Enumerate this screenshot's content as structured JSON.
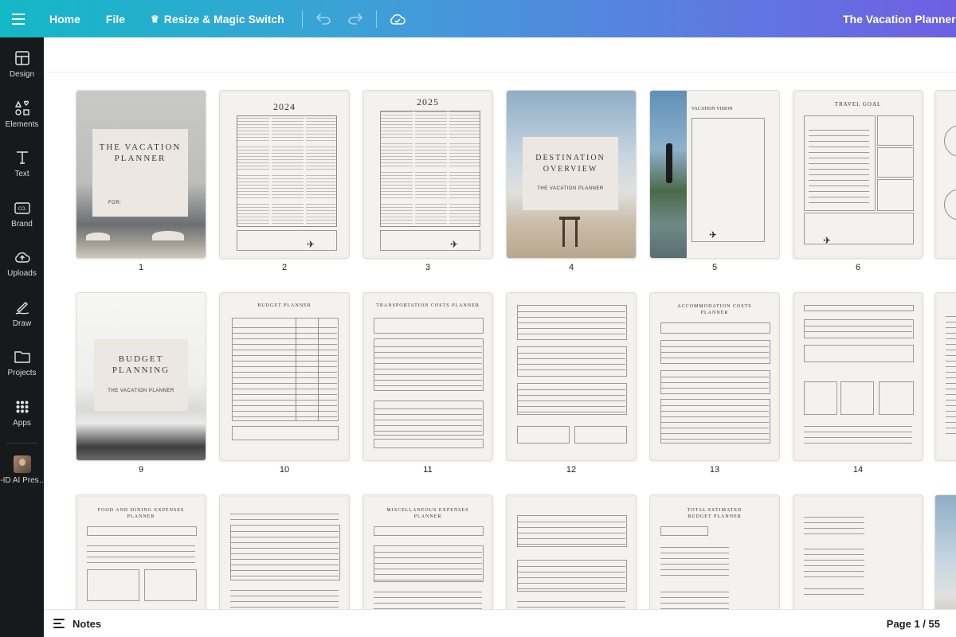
{
  "topbar": {
    "home": "Home",
    "file": "File",
    "resize": "Resize & Magic Switch",
    "title": "The Vacation Planner by"
  },
  "sidebar": {
    "items": [
      {
        "label": "Design",
        "icon": "layout-icon"
      },
      {
        "label": "Elements",
        "icon": "shapes-icon"
      },
      {
        "label": "Text",
        "icon": "text-icon"
      },
      {
        "label": "Brand",
        "icon": "brand-icon"
      },
      {
        "label": "Uploads",
        "icon": "upload-cloud-icon"
      },
      {
        "label": "Draw",
        "icon": "pen-icon"
      },
      {
        "label": "Projects",
        "icon": "folder-icon"
      },
      {
        "label": "Apps",
        "icon": "apps-grid-icon"
      }
    ],
    "profile_label": "-ID AI Pres…"
  },
  "pages": [
    {
      "num": "1",
      "title": "THE VACATION PLANNER",
      "sub": "FOR:"
    },
    {
      "num": "2",
      "title": "2024"
    },
    {
      "num": "3",
      "title": "2025"
    },
    {
      "num": "4",
      "title": "DESTINATION OVERVIEW",
      "sub": "THE VACATION PLANNER"
    },
    {
      "num": "5",
      "title": "VACATION VISION"
    },
    {
      "num": "6",
      "title": "TRAVEL GOAL"
    },
    {
      "num": "9",
      "title": "BUDGET PLANNING",
      "sub": "THE VACATION PLANNER"
    },
    {
      "num": "10",
      "title": "BUDGET PLANNER"
    },
    {
      "num": "11",
      "title": "TRANSPORTATION COSTS PLANNER"
    },
    {
      "num": "12",
      "title": ""
    },
    {
      "num": "13",
      "title": "ACCOMMODATION COSTS PLANNER"
    },
    {
      "num": "14",
      "title": ""
    },
    {
      "num": "",
      "title": "FOOD AND DINING EXPENSES PLANNER"
    },
    {
      "num": "",
      "title": ""
    },
    {
      "num": "",
      "title": "MISCELLANEOUS EXPENSES PLANNER"
    },
    {
      "num": "",
      "title": ""
    },
    {
      "num": "",
      "title": "TOTAL ESTIMATED BUDGET PLANNER"
    },
    {
      "num": "",
      "title": ""
    }
  ],
  "bottombar": {
    "notes": "Notes",
    "page_counter": "Page 1 / 55"
  }
}
